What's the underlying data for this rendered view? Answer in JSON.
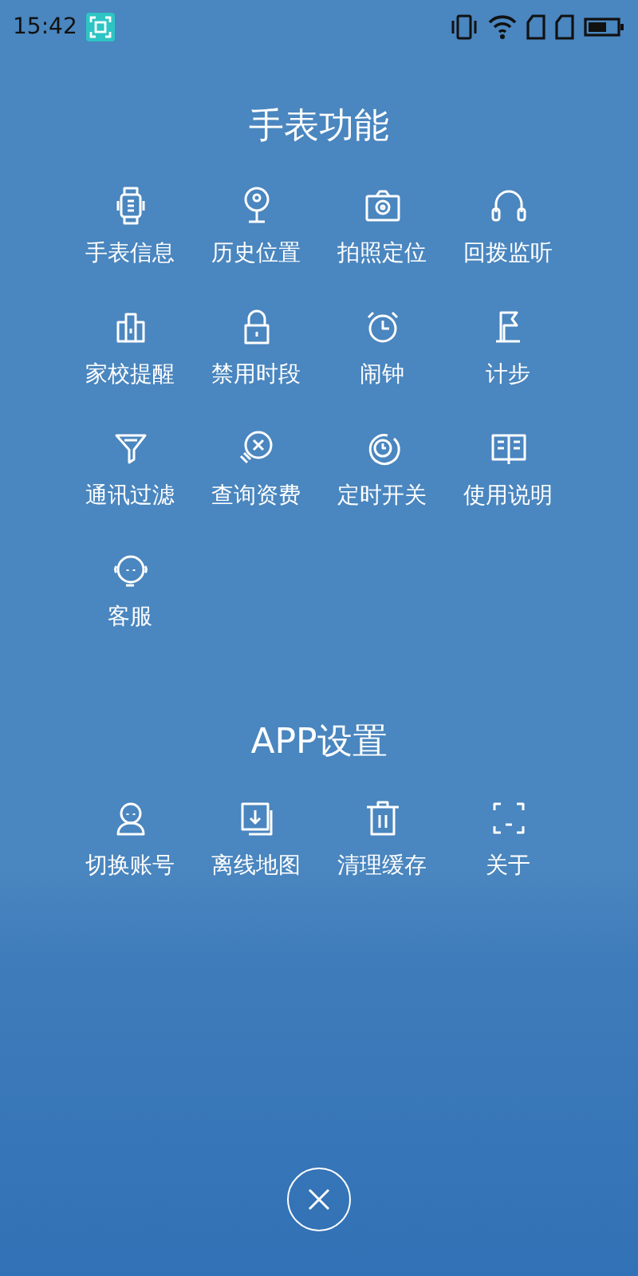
{
  "status_bar": {
    "time": "15:42"
  },
  "sections": [
    {
      "title": "手表功能",
      "items": [
        {
          "label": "手表信息"
        },
        {
          "label": "历史位置"
        },
        {
          "label": "拍照定位"
        },
        {
          "label": "回拨监听"
        },
        {
          "label": "家校提醒"
        },
        {
          "label": "禁用时段"
        },
        {
          "label": "闹钟"
        },
        {
          "label": "计步"
        },
        {
          "label": "通讯过滤"
        },
        {
          "label": "查询资费"
        },
        {
          "label": "定时开关"
        },
        {
          "label": "使用说明"
        },
        {
          "label": "客服"
        }
      ]
    },
    {
      "title": "APP设置",
      "items": [
        {
          "label": "切换账号"
        },
        {
          "label": "离线地图"
        },
        {
          "label": "清理缓存"
        },
        {
          "label": "关于"
        }
      ]
    }
  ]
}
